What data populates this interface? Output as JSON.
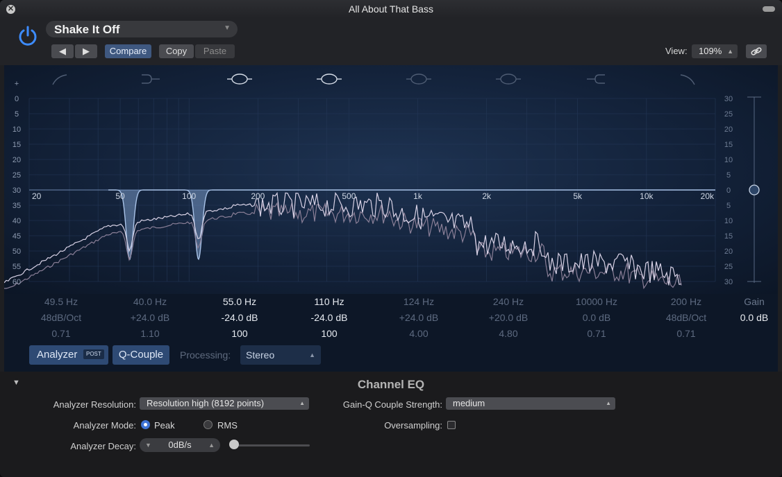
{
  "window": {
    "title": "All About That Bass"
  },
  "header": {
    "preset_name": "Shake It Off",
    "prev_label": "◀",
    "next_label": "▶",
    "compare_label": "Compare",
    "copy_label": "Copy",
    "paste_label": "Paste",
    "view_label": "View:",
    "view_value": "109%"
  },
  "graph": {
    "left_scale": [
      "+",
      "0",
      "5",
      "10",
      "15",
      "20",
      "25",
      "30",
      "35",
      "40",
      "45",
      "50",
      "55",
      "60",
      "-"
    ],
    "right_scale": [
      "30",
      "25",
      "20",
      "15",
      "10",
      "5",
      "0",
      "5",
      "10",
      "15",
      "20",
      "25",
      "30"
    ],
    "freq_labels": [
      "20",
      "50",
      "100",
      "200",
      "500",
      "1k",
      "2k",
      "5k",
      "10k",
      "20k"
    ]
  },
  "bands": [
    {
      "freq": "49.5 Hz",
      "gain": "48dB/Oct",
      "q": "0.71",
      "active": false
    },
    {
      "freq": "40.0 Hz",
      "gain": "+24.0 dB",
      "q": "1.10",
      "active": false
    },
    {
      "freq": "55.0 Hz",
      "gain": "-24.0 dB",
      "q": "100",
      "active": true
    },
    {
      "freq": "110 Hz",
      "gain": "-24.0 dB",
      "q": "100",
      "active": true
    },
    {
      "freq": "124 Hz",
      "gain": "+24.0 dB",
      "q": "4.00",
      "active": false
    },
    {
      "freq": "240 Hz",
      "gain": "+20.0 dB",
      "q": "4.80",
      "active": false
    },
    {
      "freq": "10000 Hz",
      "gain": "0.0 dB",
      "q": "0.71",
      "active": false
    },
    {
      "freq": "200 Hz",
      "gain": "48dB/Oct",
      "q": "0.71",
      "active": false
    }
  ],
  "gain": {
    "label": "Gain",
    "value": "0.0 dB",
    "level_db": 0
  },
  "analyzer_bar": {
    "analyzer_label": "Analyzer",
    "post_label": "POST",
    "qcouple_label": "Q-Couple",
    "processing_label": "Processing:",
    "processing_value": "Stereo"
  },
  "extended": {
    "section_title": "Channel EQ",
    "resolution_label": "Analyzer Resolution:",
    "resolution_value": "Resolution high (8192 points)",
    "gainq_label": "Gain-Q Couple Strength:",
    "gainq_value": "medium",
    "mode_label": "Analyzer Mode:",
    "mode_peak": "Peak",
    "mode_rms": "RMS",
    "mode_selected": "Peak",
    "oversampling_label": "Oversampling:",
    "decay_label": "Analyzer Decay:",
    "decay_value": "0dB/s"
  },
  "colors": {
    "accent_blue": "#3f5880",
    "graph_bg": "#13223a",
    "eq_curve": "#8fb0dc",
    "analyzer_line": "#b6b0c4"
  }
}
